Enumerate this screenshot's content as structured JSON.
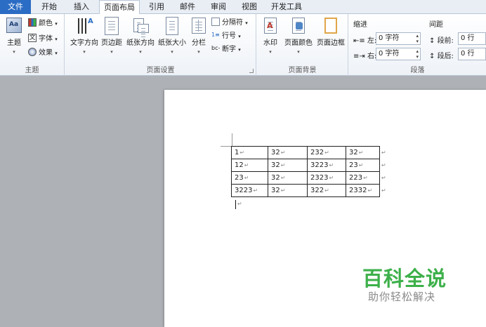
{
  "tabs": [
    {
      "label": "文件"
    },
    {
      "label": "开始"
    },
    {
      "label": "插入"
    },
    {
      "label": "页面布局"
    },
    {
      "label": "引用"
    },
    {
      "label": "邮件"
    },
    {
      "label": "审阅"
    },
    {
      "label": "视图"
    },
    {
      "label": "开发工具"
    }
  ],
  "active_tab": "页面布局",
  "ribbon": {
    "theme_group": {
      "label": "主题",
      "theme_button": "主题",
      "colors": "颜色",
      "fonts": "字体",
      "effects": "效果"
    },
    "page_setup_group": {
      "label": "页面设置",
      "text_direction": "文字方向",
      "margins": "页边距",
      "orientation": "纸张方向",
      "size": "纸张大小",
      "columns": "分栏",
      "breaks": "分隔符",
      "line_numbers": "行号",
      "hyphenation": "断字"
    },
    "page_background_group": {
      "label": "页面背景",
      "watermark": "水印",
      "page_color": "页面颜色",
      "page_borders": "页面边框"
    },
    "paragraph_group": {
      "label": "段落",
      "indent_title": "缩进",
      "indent_left_label": "左:",
      "indent_left_value": "0 字符",
      "indent_right_label": "右:",
      "indent_right_value": "0 字符",
      "spacing_title": "间距",
      "spacing_before_label": "段前:",
      "spacing_before_value": "0 行",
      "spacing_after_label": "段后:",
      "spacing_after_value": "0 行"
    }
  },
  "document": {
    "table": [
      [
        "1",
        "32",
        "232",
        "32"
      ],
      [
        "12",
        "32",
        "3223",
        "23"
      ],
      [
        "23",
        "32",
        "2323",
        "223"
      ],
      [
        "3223",
        "32",
        "322",
        "2332"
      ]
    ],
    "para_mark": "↵"
  },
  "watermark": {
    "title": "百科全说",
    "subtitle": "助你轻松解决"
  },
  "colors": {
    "file_tab": "#2b6cc4",
    "watermark_green": "#3db04a"
  }
}
